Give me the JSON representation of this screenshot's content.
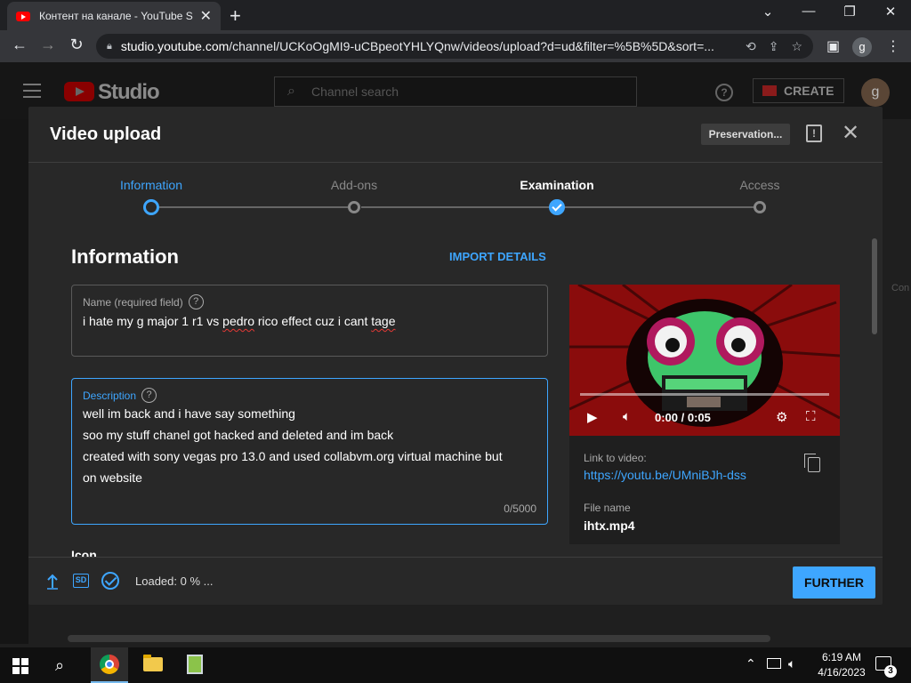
{
  "browser": {
    "tab_title": "Контент на канале - YouTube Studio",
    "tab_close": "✕",
    "new_tab": "+",
    "url_host": "studio.youtube.com",
    "url_path": "/channel/UCKoOgMI9-uCBpeotYHLYQnw/videos/upload?d=ud&filter=%5B%5D&sort=...",
    "profile_initial": "g"
  },
  "studio": {
    "logo_text": "Studio",
    "search_placeholder": "Channel search",
    "help": "?",
    "create_label": "CREATE",
    "avatar_initial": "g",
    "page_edge_text": "Con"
  },
  "dialog": {
    "title": "Video upload",
    "preservation_label": "Preservation...",
    "report": "!",
    "close": "✕",
    "steps": [
      {
        "label": "Information",
        "state": "current"
      },
      {
        "label": "Add-ons",
        "state": "pending"
      },
      {
        "label": "Examination",
        "state": "complete"
      },
      {
        "label": "Access",
        "state": "pending"
      }
    ],
    "section_title": "Information",
    "import_details": "IMPORT DETAILS",
    "name_field": {
      "label": "Name (required field)",
      "help": "?",
      "value_parts": [
        "i hate my g major 1 r1 vs ",
        "pedro",
        " rico effect cuz i cant ",
        "tage"
      ]
    },
    "description_field": {
      "label": "Description",
      "help": "?",
      "lines": [
        "well im back and i have say something",
        "soo my stuff chanel got hacked and deleted and im back",
        "created with sony vegas pro 13.0 and used collabvm.org virtual machine but",
        "on website"
      ],
      "counter": "0/5000"
    },
    "icon_heading": "Icon",
    "video": {
      "time": "0:00 / 0:05",
      "link_label": "Link to video:",
      "link": "https://youtu.be/UMniBJh-dss",
      "file_label": "File name",
      "file_name": "ihtx.mp4"
    },
    "footer": {
      "sd_label": "SD",
      "loaded_text": "Loaded: 0 % ...",
      "further_label": "FURTHER"
    }
  },
  "taskbar": {
    "time": "6:19 AM",
    "date": "4/16/2023",
    "notifications": "3"
  },
  "colors": {
    "accent": "#3ea6ff",
    "dialog_bg": "#282828",
    "brand_red": "#ff0000"
  }
}
